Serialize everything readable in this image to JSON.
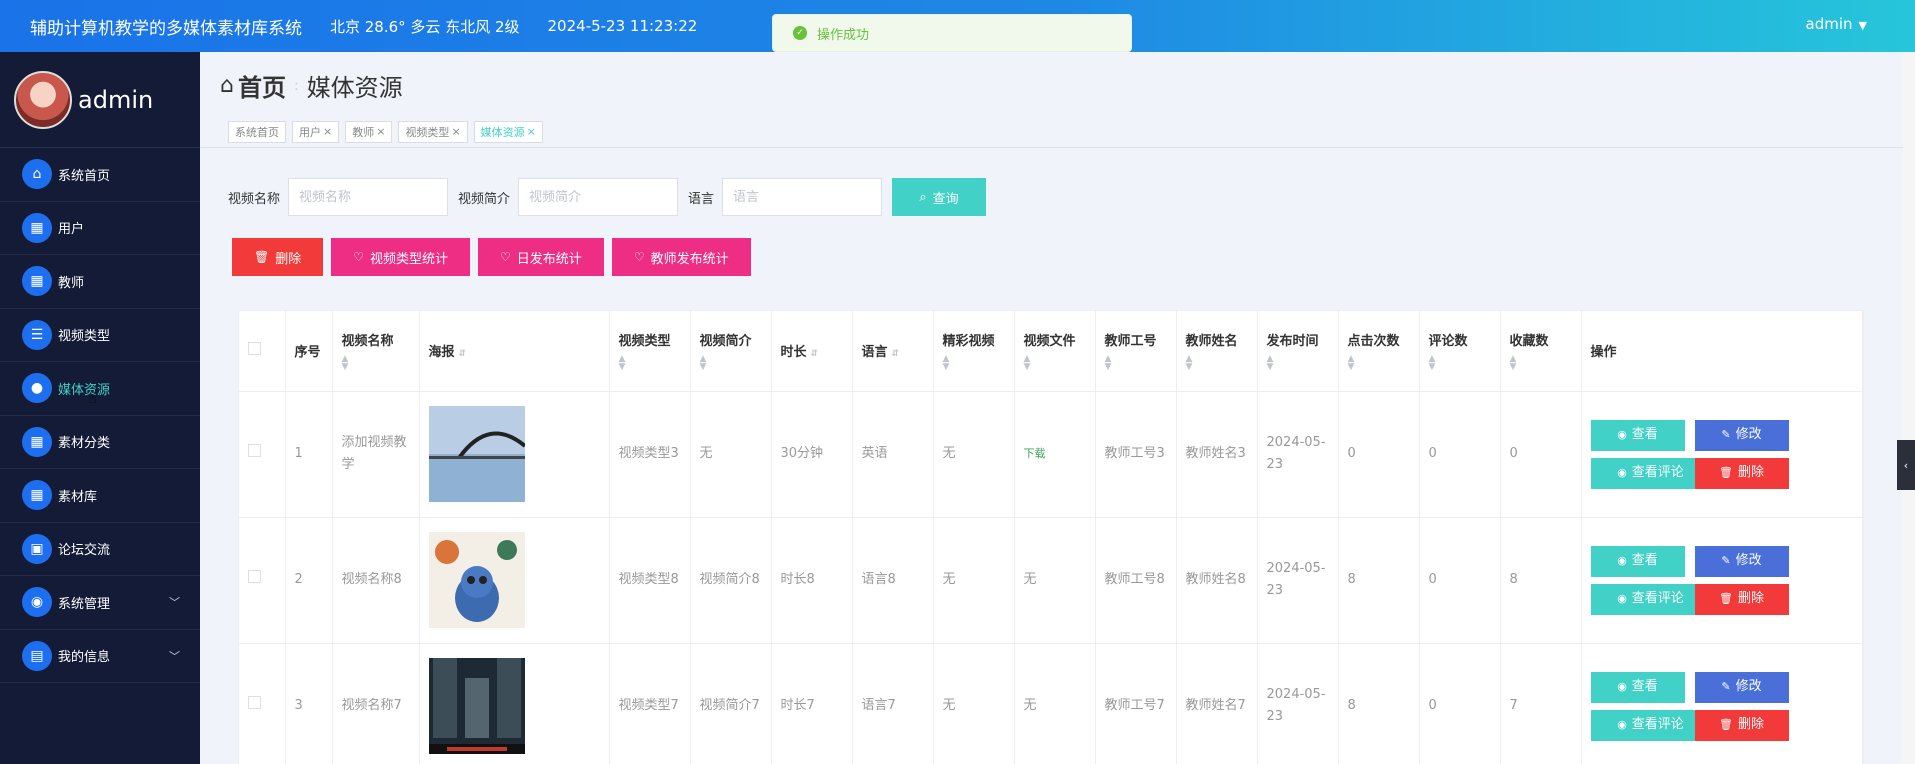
{
  "header": {
    "title": "辅助计算机教学的多媒体素材库系统",
    "weather": "北京 28.6° 多云 东北风 2级",
    "datetime": "2024-5-23 11:23:22",
    "user": "admin"
  },
  "toast": {
    "message": "操作成功"
  },
  "sidebar": {
    "username": "admin",
    "items": [
      {
        "label": "系统首页",
        "icon": "home-icon"
      },
      {
        "label": "用户",
        "icon": "grid-icon"
      },
      {
        "label": "教师",
        "icon": "grid-icon"
      },
      {
        "label": "视频类型",
        "icon": "list-icon"
      },
      {
        "label": "媒体资源",
        "icon": "person-icon"
      },
      {
        "label": "素材分类",
        "icon": "grid-icon"
      },
      {
        "label": "素材库",
        "icon": "grid-icon"
      },
      {
        "label": "论坛交流",
        "icon": "briefcase-icon"
      },
      {
        "label": "系统管理",
        "icon": "pin-icon"
      },
      {
        "label": "我的信息",
        "icon": "card-icon"
      }
    ]
  },
  "breadcrumb": {
    "home": "首页",
    "current": "媒体资源"
  },
  "tags": [
    "系统首页",
    "用户",
    "教师",
    "视频类型",
    "媒体资源"
  ],
  "search": {
    "name_label": "视频名称",
    "name_placeholder": "视频名称",
    "intro_label": "视频简介",
    "intro_placeholder": "视频简介",
    "lang_label": "语言",
    "lang_placeholder": "语言",
    "button": "查询"
  },
  "actions": {
    "delete": "删除",
    "type_stats": "视频类型统计",
    "daily_stats": "日发布统计",
    "teacher_stats": "教师发布统计"
  },
  "table": {
    "headers": {
      "index": "序号",
      "name": "视频名称",
      "poster": "海报",
      "type": "视频类型",
      "intro": "视频简介",
      "duration": "时长",
      "lang": "语言",
      "featured": "精彩视频",
      "file": "视频文件",
      "teacher_no": "教师工号",
      "teacher_name": "教师姓名",
      "date": "发布时间",
      "clicks": "点击次数",
      "comments": "评论数",
      "favorites": "收藏数",
      "ops": "操作"
    },
    "rows": [
      {
        "index": "1",
        "name": "添加视频教学",
        "type": "视频类型3",
        "intro": "无",
        "duration": "30分钟",
        "lang": "英语",
        "featured": "无",
        "file": "下载",
        "teacher_no": "教师工号3",
        "teacher_name": "教师姓名3",
        "date": "2024-05-23",
        "clicks": "0",
        "comments": "0",
        "favorites": "0"
      },
      {
        "index": "2",
        "name": "视频名称8",
        "type": "视频类型8",
        "intro": "视频简介8",
        "duration": "时长8",
        "lang": "语言8",
        "featured": "无",
        "file": "无",
        "teacher_no": "教师工号8",
        "teacher_name": "教师姓名8",
        "date": "2024-05-23",
        "clicks": "8",
        "comments": "0",
        "favorites": "8"
      },
      {
        "index": "3",
        "name": "视频名称7",
        "type": "视频类型7",
        "intro": "视频简介7",
        "duration": "时长7",
        "lang": "语言7",
        "featured": "无",
        "file": "无",
        "teacher_no": "教师工号7",
        "teacher_name": "教师姓名7",
        "date": "2024-05-23",
        "clicks": "8",
        "comments": "0",
        "favorites": "7"
      }
    ],
    "op_labels": {
      "view": "查看",
      "edit": "修改",
      "comments": "查看评论",
      "delete": "删除"
    }
  }
}
